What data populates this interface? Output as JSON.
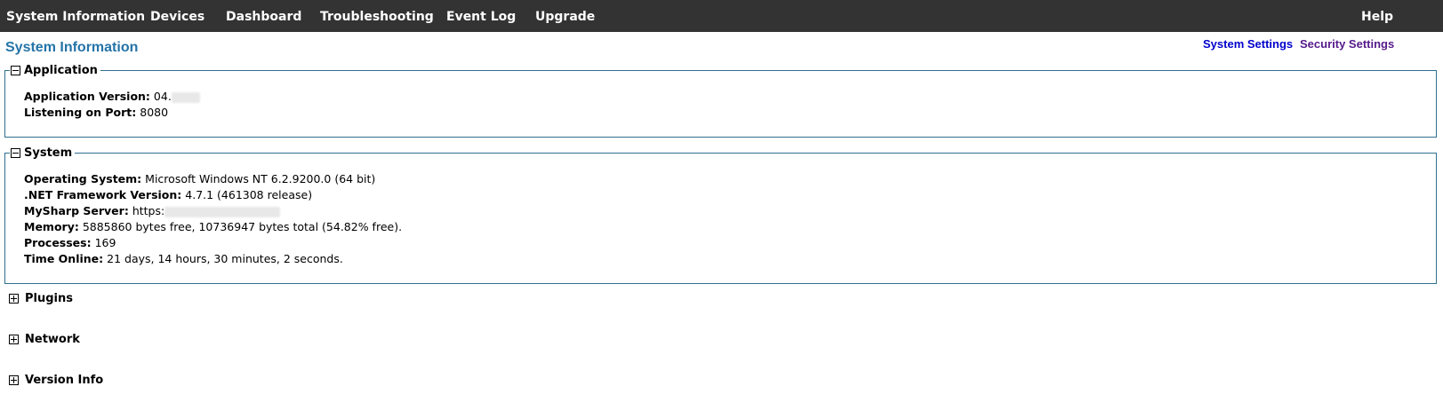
{
  "nav": {
    "items": [
      "System Information",
      "Devices",
      "Dashboard",
      "Troubleshooting",
      "Event Log",
      "Upgrade"
    ],
    "help": "Help",
    "background": "#333333"
  },
  "page": {
    "title": "System Information",
    "title_color": "#2473a8"
  },
  "links": {
    "system_settings": "System Settings",
    "security_settings": "Security Settings",
    "system_settings_color": "#0000cc",
    "security_settings_color": "#551a8b"
  },
  "application": {
    "title": "Application",
    "version_label": "Application Version:",
    "version_value": "04.",
    "port_label": "Listening on Port:",
    "port_value": "8080"
  },
  "system": {
    "title": "System",
    "os_label": "Operating System:",
    "os_value": "Microsoft Windows NT 6.2.9200.0 (64 bit)",
    "net_label": ".NET Framework Version:",
    "net_value": "4.7.1 (461308 release)",
    "mysharp_label": "MySharp Server:",
    "mysharp_value": "https:",
    "memory_label": "Memory:",
    "memory_value": "5885860 bytes free, 10736947 bytes total (54.82% free).",
    "processes_label": "Processes:",
    "processes_value": "169",
    "online_label": "Time Online:",
    "online_value": "21 days, 14 hours, 30 minutes, 2 seconds."
  },
  "collapsed_sections": [
    "Plugins",
    "Network",
    "Version Info"
  ]
}
